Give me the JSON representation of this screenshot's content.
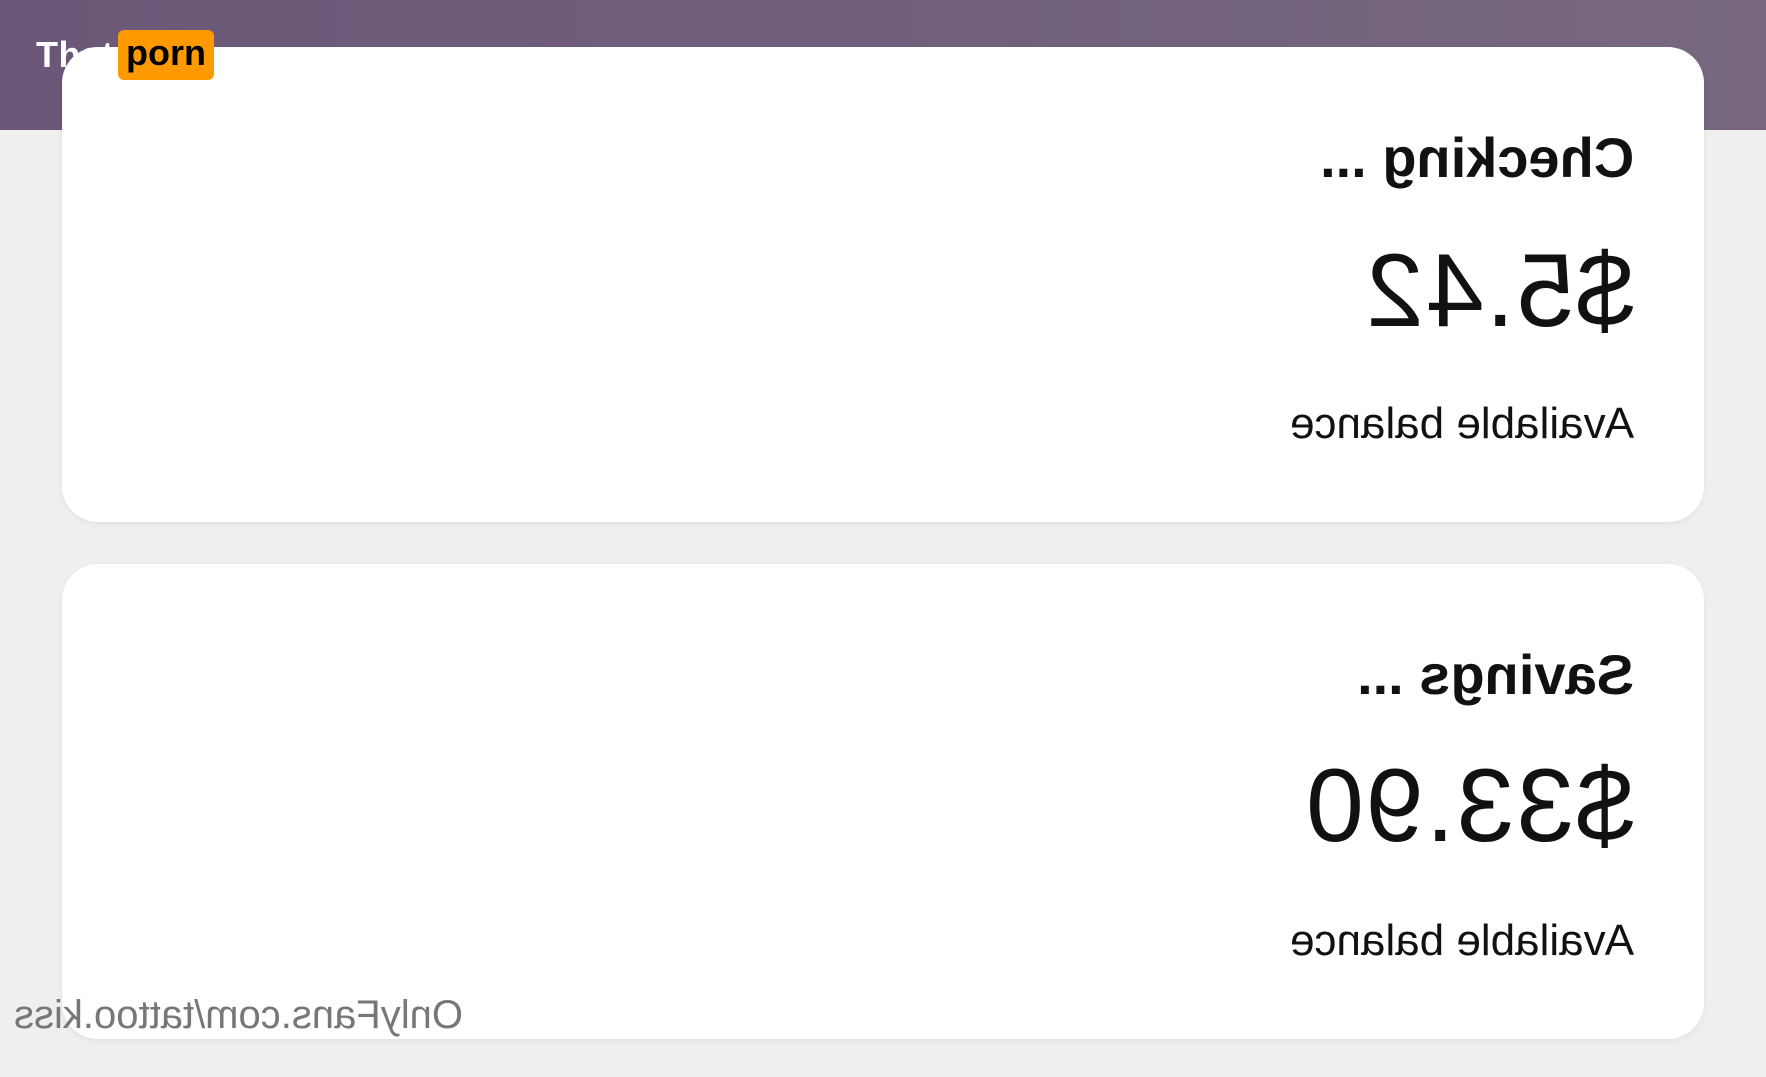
{
  "header": {
    "logo": {
      "text_white": "That",
      "text_badge": "porn"
    }
  },
  "accounts": [
    {
      "title": "Checking ...",
      "amount": "$5.42",
      "caption": "Available balance"
    },
    {
      "title": "Savings ...",
      "amount": "$33.90",
      "caption": "Available balance"
    }
  ],
  "watermark": "OnlyFans.com/tattoo.kiss",
  "colors": {
    "header_band": "#6f5f7c",
    "page_background": "#f1efed",
    "card_background": "#ffffff",
    "logo_badge": "#ff9900"
  }
}
